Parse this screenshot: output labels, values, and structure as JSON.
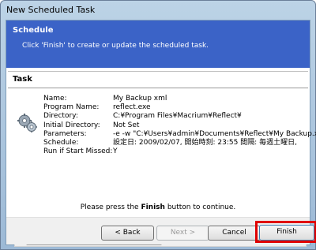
{
  "window": {
    "title": "New Scheduled Task"
  },
  "header": {
    "title": "Schedule",
    "subtitle": "Click 'Finish' to create or update the scheduled task."
  },
  "task_group": {
    "title": "Task",
    "icon": "gears-icon",
    "rows": [
      {
        "label": "Name:",
        "value": "My Backup xml"
      },
      {
        "label": "Program Name:",
        "value": "reflect.exe"
      },
      {
        "label": "Directory:",
        "value": "C:¥Program Files¥Macrium¥Reflect¥"
      },
      {
        "label": "Initial Directory:",
        "value": "Not Set"
      },
      {
        "label": "Parameters:",
        "value": "-e -w \"C:¥Users¥admin¥Documents¥Reflect¥My Backup.xml\""
      },
      {
        "label": "Schedule:",
        "value": "設定日: 2009/02/07, 開始時刻: 23:55  間隔: 毎週土曜日,"
      },
      {
        "label": "Run if Start Missed:",
        "value": "Y"
      }
    ]
  },
  "press_text": {
    "before": "Please press the ",
    "bold": "Finish",
    "after": " button to continue."
  },
  "buttons": {
    "back": "< Back",
    "next": "Next >",
    "cancel": "Cancel",
    "finish": "Finish"
  },
  "highlight_color": "#e00000"
}
